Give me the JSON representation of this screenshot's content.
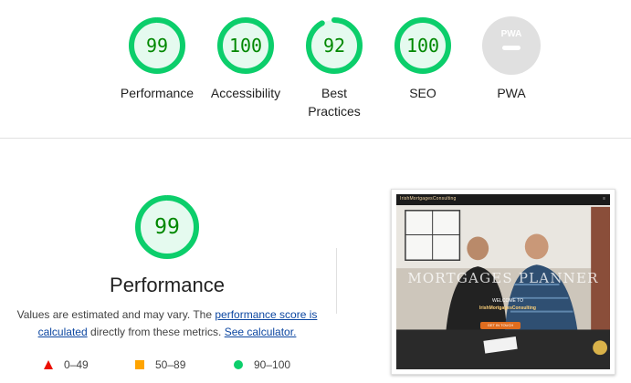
{
  "colors": {
    "pass_fg": "#008800",
    "pass_ring": "#0cce6b",
    "pass_bg": "#e5faef",
    "link": "#0d47a1",
    "fail": "#eb0f00",
    "average": "#ffa400",
    "pwa_gray": "#e0e0e0"
  },
  "categories": [
    {
      "label": "Performance",
      "score": 99
    },
    {
      "label": "Accessibility",
      "score": 100
    },
    {
      "label": "Best Practices",
      "score": 92
    },
    {
      "label": "SEO",
      "score": 100
    }
  ],
  "pwa": {
    "label": "PWA",
    "badge_text": "PWA",
    "icon": "pwa-badge-icon"
  },
  "main": {
    "score": 99,
    "title": "Performance",
    "note_prefix": "Values are estimated and may vary. The ",
    "note_link1": "performance score is calculated",
    "note_middle": " directly from these metrics. ",
    "note_link2": "See calculator."
  },
  "legend": [
    {
      "range": "0–49",
      "icon": "red-triangle-icon"
    },
    {
      "range": "50–89",
      "icon": "orange-square-icon"
    },
    {
      "range": "90–100",
      "icon": "green-circle-icon"
    }
  ],
  "screenshot": {
    "brand": "IrishMortgagesConsulting",
    "menu": "≡",
    "headline": "MORTGAGES PLANNER",
    "sub_line1": "WELCOME TO",
    "sub_brand": "IrishMortgagesConsulting",
    "cta": "GET IN TOUCH"
  }
}
